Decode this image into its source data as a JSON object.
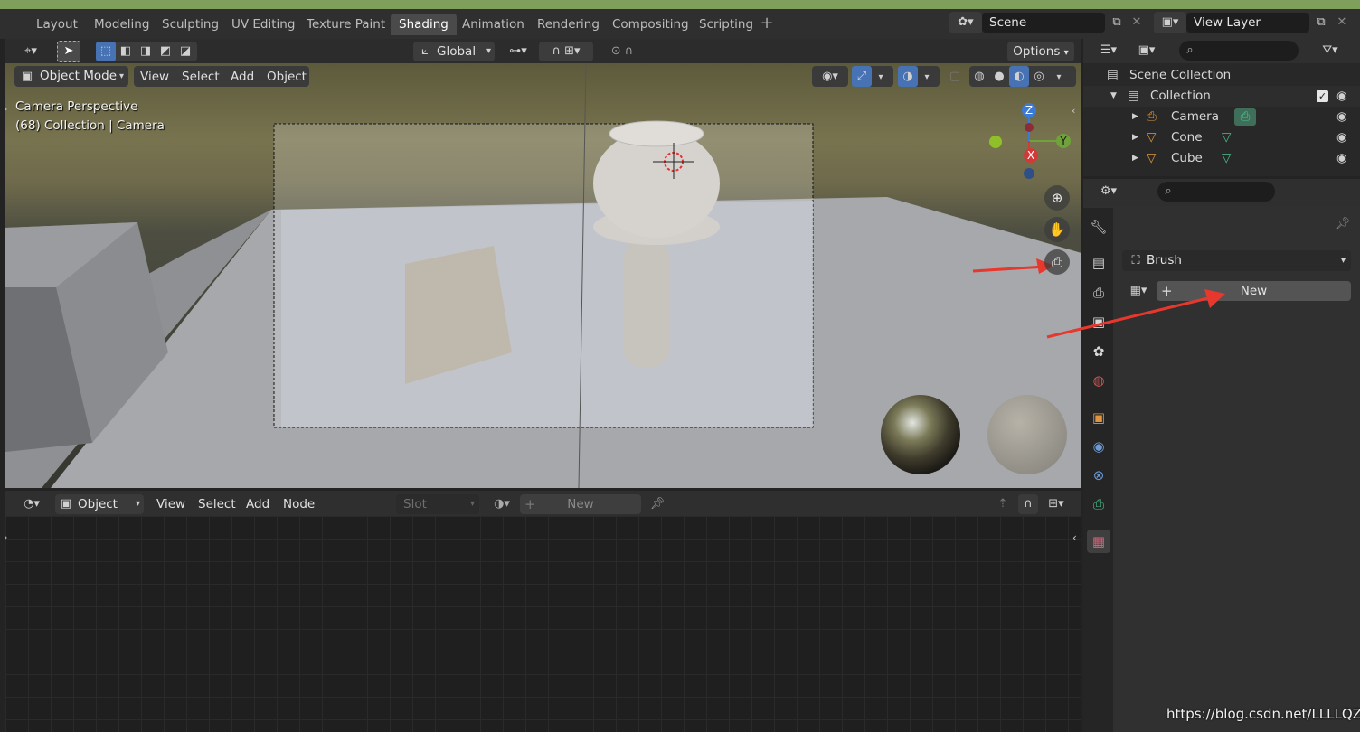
{
  "tabs": [
    {
      "label": "Layout"
    },
    {
      "label": "Modeling"
    },
    {
      "label": "Sculpting"
    },
    {
      "label": "UV Editing"
    },
    {
      "label": "Texture Paint"
    },
    {
      "label": "Shading"
    },
    {
      "label": "Animation"
    },
    {
      "label": "Rendering"
    },
    {
      "label": "Compositing"
    },
    {
      "label": "Scripting"
    }
  ],
  "active_tab": "Shading",
  "scene": {
    "label": "Scene"
  },
  "view_layer": {
    "label": "View Layer"
  },
  "viewport_header": {
    "orientation": "Global",
    "options": "Options"
  },
  "viewport_menu": {
    "mode": "Object Mode",
    "items": [
      "View",
      "Select",
      "Add",
      "Object"
    ]
  },
  "viewport_overlay": {
    "line1": "Camera Perspective",
    "line2": "(68) Collection | Camera"
  },
  "gizmo": {
    "z": "Z",
    "x": "X",
    "y": "Y"
  },
  "node_editor": {
    "type": "Object",
    "items": [
      "View",
      "Select",
      "Add",
      "Node"
    ],
    "slot": "Slot",
    "new": "New"
  },
  "outliner": {
    "root": "Scene Collection",
    "collection": "Collection",
    "items": [
      {
        "label": "Camera"
      },
      {
        "label": "Cone"
      },
      {
        "label": "Cube"
      }
    ]
  },
  "properties": {
    "brush": "Brush",
    "new": "New"
  },
  "watermark": "https://blog.csdn.net/LLLLQZ",
  "colors": {
    "accent": "#4772b3",
    "arrow": "#e8372d",
    "outliner_green": "#4dbf8b"
  }
}
